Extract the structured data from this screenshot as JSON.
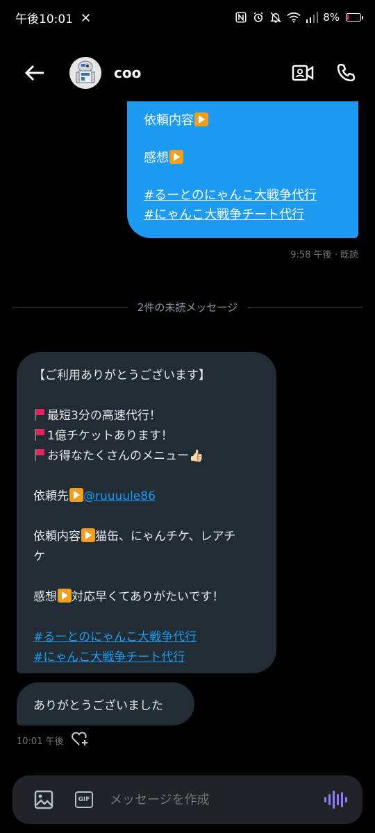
{
  "status_bar": {
    "time": "午後10:01",
    "x_app": "X",
    "battery": "8%",
    "battery_level": 0.08
  },
  "header": {
    "contact_name": "coo",
    "icons": [
      "back-arrow-icon",
      "avatar-robot",
      "video-camera-icon",
      "phone-icon"
    ]
  },
  "sent_message": {
    "line1_label": "依頼内容",
    "line2_label": "感想",
    "tag1": "#るーとのにゃんこ大戦争代行",
    "tag2": "#にゃんこ大戦争チート代行",
    "meta": "9:58 午後 · 既読"
  },
  "unread_divider": "2件の未読メッセージ",
  "received_message": {
    "title": "【ご利用ありがとうございます】",
    "bullet1": "最短3分の高速代行！",
    "bullet2": "1億チケットあります！",
    "bullet3": "お得なたくさんのメニュー👍🏻",
    "contact_label": "依頼先",
    "contact_link": "@ruuuule86",
    "request_label": "依頼内容",
    "request_text": "猫缶、にゃんチケ、レアチ",
    "request_text_cont": "ケ",
    "review_label": "感想",
    "review_text": "対応早くてありがたいです！",
    "tag1": "#るーとのにゃんこ大戦争代行",
    "tag2": "#にゃんこ大戦争チート代行"
  },
  "received_message2": {
    "text": "ありがとうございました",
    "meta": "10:01 午後"
  },
  "composer": {
    "placeholder": "メッセージを作成",
    "gif_label": "GIF"
  },
  "colors": {
    "accent": "#1d9bf0",
    "bubble_received": "#222c35",
    "background": "#000000",
    "voice": "#8f7bf5"
  }
}
